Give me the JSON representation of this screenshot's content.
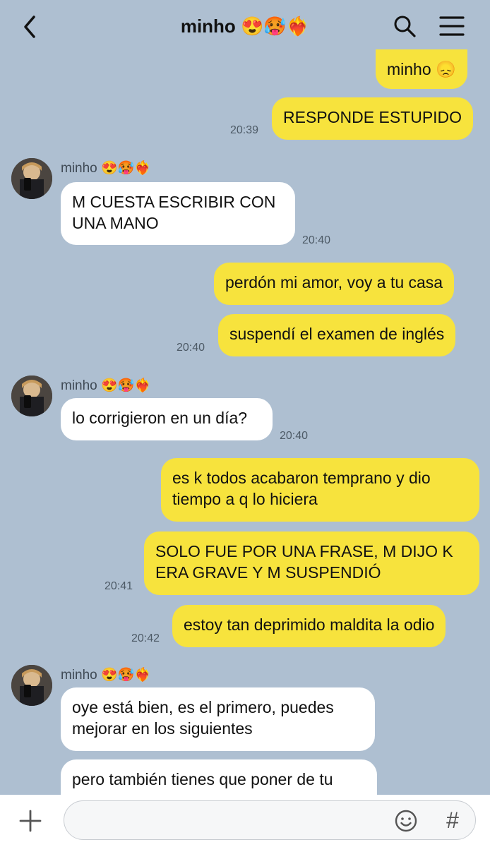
{
  "header": {
    "contact_name": "minho 😍🥵❤️‍🔥",
    "back_icon": "chevron-left-icon",
    "search_icon": "search-icon",
    "menu_icon": "hamburger-menu-icon"
  },
  "messages": [
    {
      "from": "me",
      "text": "minho 😞",
      "time": ""
    },
    {
      "from": "me",
      "text": "RESPONDE ESTUPIDO",
      "time": "20:39"
    },
    {
      "from": "them",
      "sender": "minho 😍🥵❤️‍🔥",
      "text": "M CUESTA ESCRIBIR CON\nUNA MANO",
      "time": "20:40"
    },
    {
      "from": "me",
      "text": "perdón mi amor, voy a tu casa",
      "time": ""
    },
    {
      "from": "me",
      "text": "suspendí el examen de inglés",
      "time": "20:40"
    },
    {
      "from": "them",
      "sender": "minho 😍🥵❤️‍🔥",
      "text": "lo corrigieron en un día?",
      "time": "20:40"
    },
    {
      "from": "me",
      "text": "es k todos acabaron temprano y dio\ntiempo a q lo hiciera",
      "time": ""
    },
    {
      "from": "me",
      "text": "SOLO FUE POR UNA FRASE, M DIJO K\nERA GRAVE Y M SUSPENDIÓ",
      "time": "20:41"
    },
    {
      "from": "me",
      "text": "estoy tan deprimido maldita la odio",
      "time": "20:42"
    },
    {
      "from": "them",
      "sender": "minho 😍🥵❤️‍🔥",
      "text": "oye está bien, es el primero, puedes\nmejorar en los siguientes",
      "time": ""
    },
    {
      "from": "them",
      "text": "pero también tienes que poner de tu",
      "time": ""
    }
  ],
  "input": {
    "plus_icon": "plus-icon",
    "value": "",
    "emoji_icon": "emoji-smile-icon",
    "hash_label": "#"
  }
}
